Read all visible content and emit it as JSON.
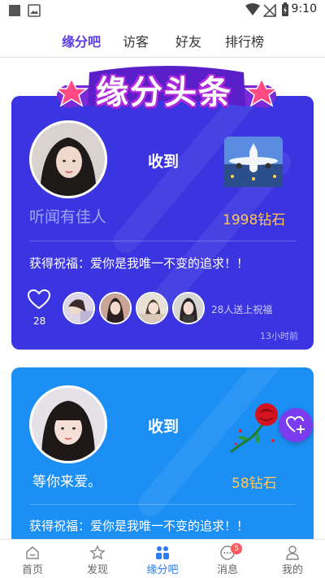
{
  "status_bar": {
    "time": "9:10"
  },
  "top_tabs": [
    {
      "label": "缘分吧",
      "active": true
    },
    {
      "label": "访客",
      "active": false
    },
    {
      "label": "好友",
      "active": false
    },
    {
      "label": "排行榜",
      "active": false
    }
  ],
  "banner": {
    "title": "缘分头条"
  },
  "cards": [
    {
      "received_label": "收到",
      "nickname": "听闻有佳人",
      "gift_icon": "airplane-icon",
      "gift_value": "1998钻石",
      "blessing": "获得祝福：爱你是我唯一不变的追求！！",
      "like_count": "28",
      "sent_text": "28人送上祝福",
      "time_ago": "13小时前"
    },
    {
      "received_label": "收到",
      "nickname": "等你来爱。",
      "gift_icon": "rose-icon",
      "gift_value": "58钻石",
      "blessing": "获得祝福：爱你是我唯一不变的追求！！"
    }
  ],
  "bottom_nav": [
    {
      "label": "首页",
      "icon": "home-icon",
      "active": false
    },
    {
      "label": "发现",
      "icon": "star-icon",
      "active": false
    },
    {
      "label": "缘分吧",
      "icon": "people-icon",
      "active": true
    },
    {
      "label": "消息",
      "icon": "chat-icon",
      "active": false,
      "badge": "5"
    },
    {
      "label": "我的",
      "icon": "user-icon",
      "active": false
    }
  ],
  "colors": {
    "accent": "#5b3ce8",
    "card1_bg": "#3a35e0",
    "card2_bg": "#1c8ff5",
    "gold": "#ffc655",
    "nav_active": "#2d7cf0"
  }
}
